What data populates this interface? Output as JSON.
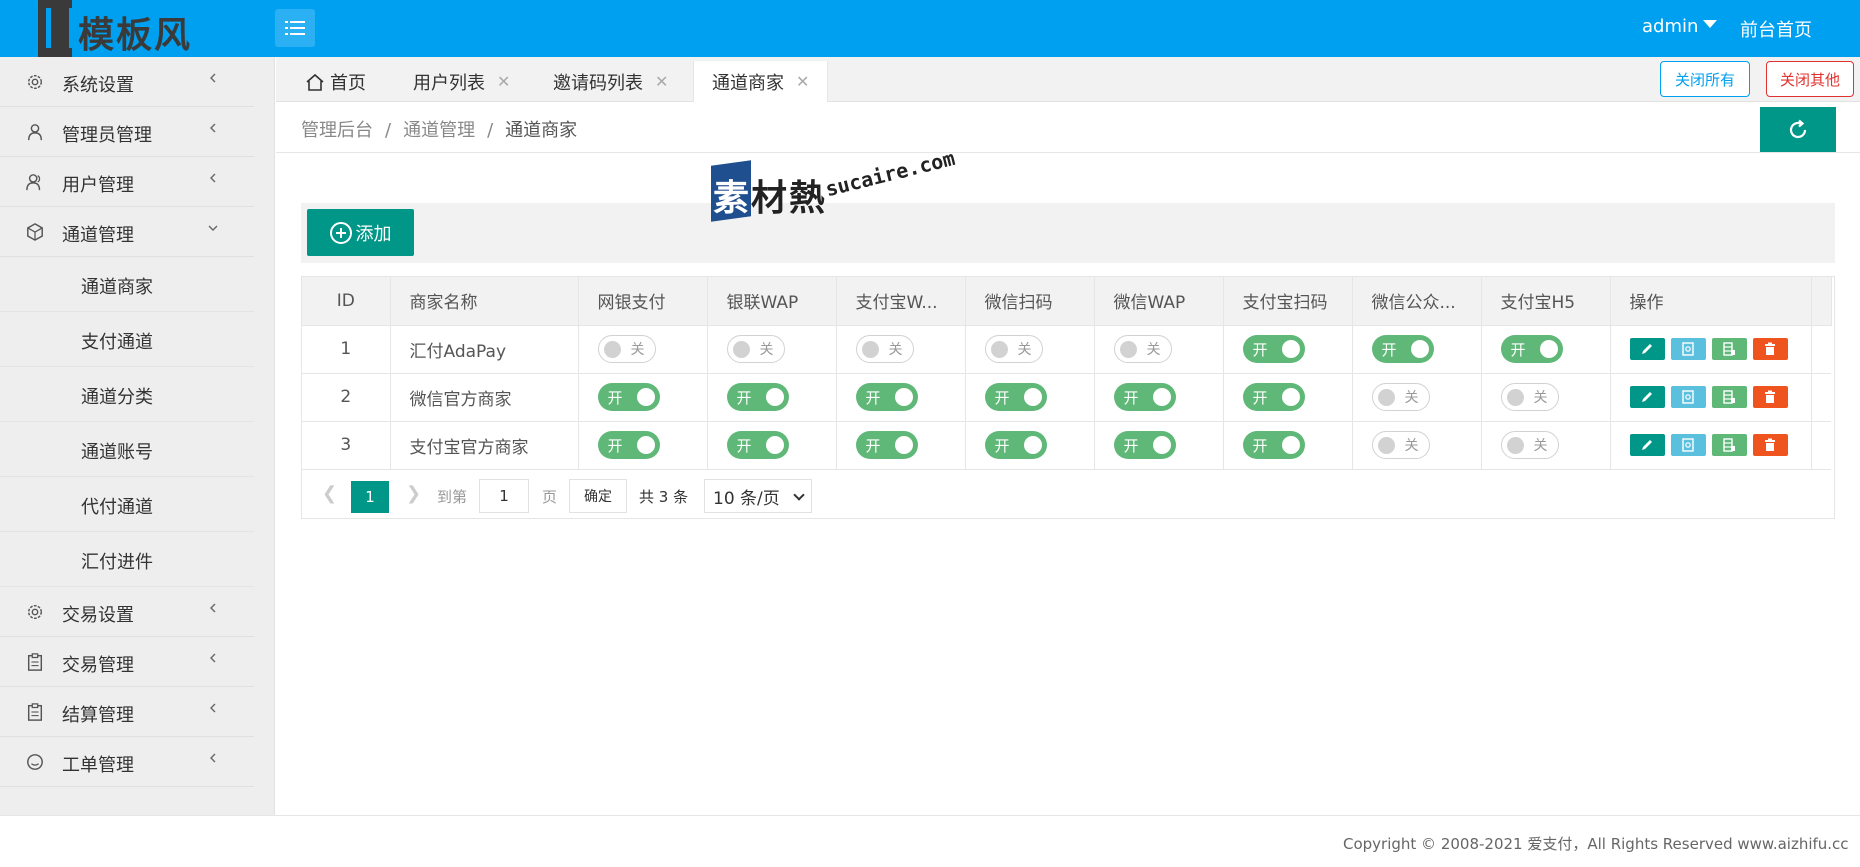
{
  "header": {
    "logo_text": "模板风",
    "user": "admin",
    "front_link": "前台首页",
    "brand_color": "#00a0f0"
  },
  "sidebar": {
    "items": [
      {
        "label": "系统设置",
        "icon": "gear-icon"
      },
      {
        "label": "管理员管理",
        "icon": "user-icon"
      },
      {
        "label": "用户管理",
        "icon": "users-icon"
      },
      {
        "label": "通道管理",
        "icon": "cube-icon",
        "expanded": true
      }
    ],
    "sub_items": [
      "通道商家",
      "支付通道",
      "通道分类",
      "通道账号",
      "代付通道",
      "汇付进件"
    ],
    "items_after": [
      {
        "label": "交易设置",
        "icon": "gear-icon"
      },
      {
        "label": "交易管理",
        "icon": "clipboard-icon"
      },
      {
        "label": "结算管理",
        "icon": "clipboard-icon"
      },
      {
        "label": "工单管理",
        "icon": "smile-icon"
      }
    ]
  },
  "tabs": [
    {
      "label": "首页",
      "icon": "home-icon"
    },
    {
      "label": "用户列表"
    },
    {
      "label": "邀请码列表"
    },
    {
      "label": "通道商家",
      "active": true
    }
  ],
  "tab_actions": {
    "close_all": "关闭所有",
    "close_other": "关闭其他"
  },
  "breadcrumb": [
    "管理后台",
    "通道管理",
    "通道商家"
  ],
  "watermark": {
    "cn_first": "素",
    "cn_rest": "材熱",
    "en": "sucaire.com"
  },
  "toolbar": {
    "add_label": "添加"
  },
  "table": {
    "columns": [
      "ID",
      "商家名称",
      "网银支付",
      "银联WAP",
      "支付宝W...",
      "微信扫码",
      "微信WAP",
      "支付宝扫码",
      "微信公众...",
      "支付宝H5",
      "操作"
    ],
    "switch_on_label": "开",
    "switch_off_label": "关",
    "rows": [
      {
        "id": "1",
        "name": "汇付AdaPay",
        "switches": [
          false,
          false,
          false,
          false,
          false,
          true,
          true,
          true
        ]
      },
      {
        "id": "2",
        "name": "微信官方商家",
        "switches": [
          true,
          true,
          true,
          true,
          true,
          true,
          false,
          false
        ]
      },
      {
        "id": "3",
        "name": "支付宝官方商家",
        "switches": [
          true,
          true,
          true,
          true,
          true,
          true,
          false,
          false
        ]
      }
    ],
    "op_colors": {
      "edit": "#009688",
      "info": "#5bc0de",
      "config": "#5fb878",
      "delete": "#f0541e"
    }
  },
  "pager": {
    "current": "1",
    "goto_label": "到第",
    "goto_value": "1",
    "page_unit": "页",
    "confirm": "确定",
    "total": "共 3 条",
    "page_size": "10 条/页"
  },
  "footer": {
    "copyright": "Copyright © 2008-2021 爱支付，All Rights Reserved www.aizhifu.cc"
  }
}
